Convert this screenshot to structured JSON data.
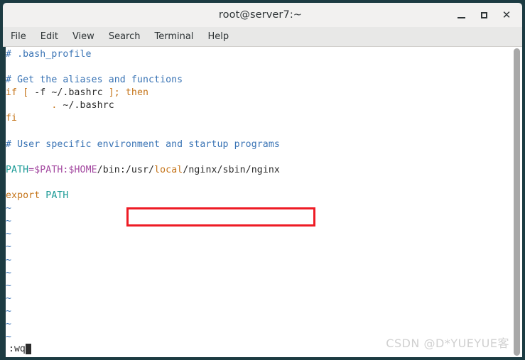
{
  "window": {
    "title": "root@server7:~",
    "controls": {
      "minimize_label": "–",
      "maximize_label": "",
      "close_label": "✕"
    },
    "frame_color": "#1c3b42",
    "titlebar_color": "#f2f1f0"
  },
  "menubar": {
    "items": [
      {
        "label": "File"
      },
      {
        "label": "Edit"
      },
      {
        "label": "View"
      },
      {
        "label": "Search"
      },
      {
        "label": "Terminal"
      },
      {
        "label": "Help"
      }
    ]
  },
  "editor": {
    "program": "vim",
    "filename": ".bash_profile",
    "background": "#ffffff",
    "lines": [
      {
        "n": 1,
        "segments": [
          {
            "text": "# .bash_profile",
            "style": "comment"
          }
        ]
      },
      {
        "n": 2,
        "segments": [
          {
            "text": "",
            "style": "plain"
          }
        ]
      },
      {
        "n": 3,
        "segments": [
          {
            "text": "# Get the aliases and functions",
            "style": "comment"
          }
        ]
      },
      {
        "n": 4,
        "segments": [
          {
            "text": "if",
            "style": "keyword"
          },
          {
            "text": " ",
            "style": "plain"
          },
          {
            "text": "[",
            "style": "keyword"
          },
          {
            "text": " -f ~/.bashrc ",
            "style": "plain"
          },
          {
            "text": "]",
            "style": "keyword"
          },
          {
            "text": ";",
            "style": "keyword"
          },
          {
            "text": " ",
            "style": "plain"
          },
          {
            "text": "then",
            "style": "keyword"
          }
        ]
      },
      {
        "n": 5,
        "segments": [
          {
            "text": "        ",
            "style": "plain"
          },
          {
            "text": ".",
            "style": "keyword"
          },
          {
            "text": " ~/.bashrc",
            "style": "plain"
          }
        ]
      },
      {
        "n": 6,
        "segments": [
          {
            "text": "fi",
            "style": "keyword"
          }
        ]
      },
      {
        "n": 7,
        "segments": [
          {
            "text": "",
            "style": "plain"
          }
        ]
      },
      {
        "n": 8,
        "segments": [
          {
            "text": "# User specific environment and startup programs",
            "style": "comment"
          }
        ]
      },
      {
        "n": 9,
        "segments": [
          {
            "text": "",
            "style": "plain"
          }
        ]
      },
      {
        "n": 10,
        "segments": [
          {
            "text": "PATH",
            "style": "var"
          },
          {
            "text": "=",
            "style": "dollar"
          },
          {
            "text": "$PATH",
            "style": "dollar"
          },
          {
            "text": ":",
            "style": "dollar"
          },
          {
            "text": "$HOME",
            "style": "dollar"
          },
          {
            "text": "/bin:/usr/",
            "style": "plain"
          },
          {
            "text": "local",
            "style": "keyword"
          },
          {
            "text": "/nginx/sbin/nginx",
            "style": "plain"
          }
        ]
      },
      {
        "n": 11,
        "segments": [
          {
            "text": "",
            "style": "plain"
          }
        ]
      },
      {
        "n": 12,
        "segments": [
          {
            "text": "export",
            "style": "keyword"
          },
          {
            "text": " ",
            "style": "plain"
          },
          {
            "text": "PATH",
            "style": "var"
          }
        ]
      },
      {
        "n": 13,
        "segments": [
          {
            "text": "~",
            "style": "tilde"
          }
        ]
      },
      {
        "n": 14,
        "segments": [
          {
            "text": "~",
            "style": "tilde"
          }
        ]
      },
      {
        "n": 15,
        "segments": [
          {
            "text": "~",
            "style": "tilde"
          }
        ]
      },
      {
        "n": 16,
        "segments": [
          {
            "text": "~",
            "style": "tilde"
          }
        ]
      },
      {
        "n": 17,
        "segments": [
          {
            "text": "~",
            "style": "tilde"
          }
        ]
      },
      {
        "n": 18,
        "segments": [
          {
            "text": "~",
            "style": "tilde"
          }
        ]
      },
      {
        "n": 19,
        "segments": [
          {
            "text": "~",
            "style": "tilde"
          }
        ]
      },
      {
        "n": 20,
        "segments": [
          {
            "text": "~",
            "style": "tilde"
          }
        ]
      },
      {
        "n": 21,
        "segments": [
          {
            "text": "~",
            "style": "tilde"
          }
        ]
      },
      {
        "n": 22,
        "segments": [
          {
            "text": "~",
            "style": "tilde"
          }
        ]
      },
      {
        "n": 23,
        "segments": [
          {
            "text": "~",
            "style": "tilde"
          }
        ]
      }
    ],
    "status_command": ":wq",
    "colors": {
      "comment": "#3a74b5",
      "keyword": "#c57419",
      "variable": "#1a9a96",
      "dollar_var": "#a348a0",
      "plain": "#2c2c2c",
      "tilde": "#3a74b5"
    }
  },
  "annotation": {
    "highlight_box_color": "#ee1c25",
    "highlight_target": ":/usr/local/nginx/sbin/nginx"
  },
  "watermark": {
    "text": "CSDN @D*YUEYUE客"
  },
  "scrollbar": {
    "thumb_color": "#a8a8a8"
  }
}
